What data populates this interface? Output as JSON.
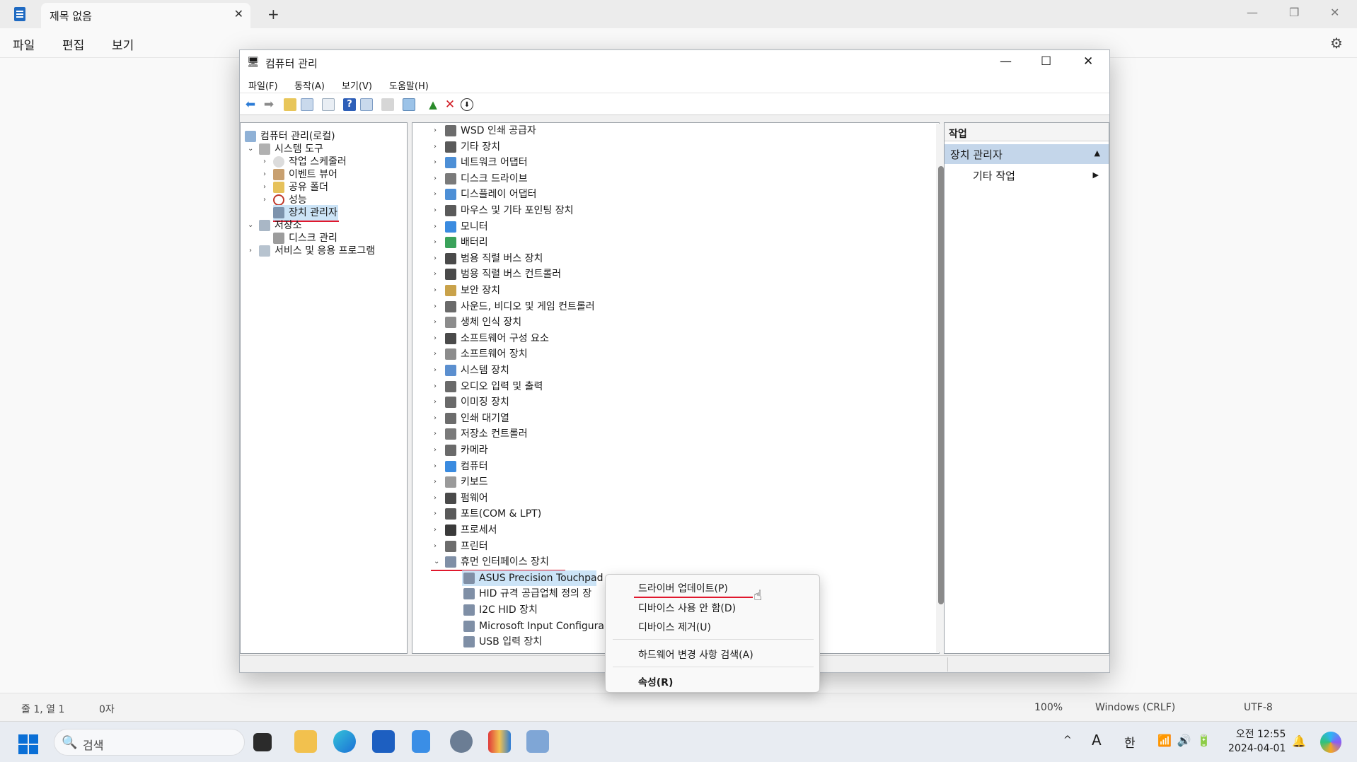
{
  "notepad": {
    "tab_title": "제목 없음",
    "menu": [
      "파일",
      "편집",
      "보기"
    ],
    "status": {
      "position": "줄 1, 열 1",
      "chars": "0자",
      "zoom": "100%",
      "eol": "Windows (CRLF)",
      "encoding": "UTF-8"
    }
  },
  "cm": {
    "title": "컴퓨터 관리",
    "menu": [
      "파일(F)",
      "동작(A)",
      "보기(V)",
      "도움말(H)"
    ],
    "tree": [
      {
        "label": "컴퓨터 관리(로컬)"
      },
      {
        "label": "시스템 도구"
      },
      {
        "label": "작업 스케줄러"
      },
      {
        "label": "이벤트 뷰어"
      },
      {
        "label": "공유 폴더"
      },
      {
        "label": "성능"
      },
      {
        "label": "장치 관리자"
      },
      {
        "label": "저장소"
      },
      {
        "label": "디스크 관리"
      },
      {
        "label": "서비스 및 응용 프로그램"
      }
    ],
    "devices": [
      {
        "label": "WSD 인쇄 공급자"
      },
      {
        "label": "기타 장치"
      },
      {
        "label": "네트워크 어댑터"
      },
      {
        "label": "디스크 드라이브"
      },
      {
        "label": "디스플레이 어댑터"
      },
      {
        "label": "마우스 및 기타 포인팅 장치"
      },
      {
        "label": "모니터"
      },
      {
        "label": "배터리"
      },
      {
        "label": "범용 직렬 버스 장치"
      },
      {
        "label": "범용 직렬 버스 컨트롤러"
      },
      {
        "label": "보안 장치"
      },
      {
        "label": "사운드, 비디오 및 게임 컨트롤러"
      },
      {
        "label": "생체 인식 장치"
      },
      {
        "label": "소프트웨어 구성 요소"
      },
      {
        "label": "소프트웨어 장치"
      },
      {
        "label": "시스템 장치"
      },
      {
        "label": "오디오 입력 및 출력"
      },
      {
        "label": "이미징 장치"
      },
      {
        "label": "인쇄 대기열"
      },
      {
        "label": "저장소 컨트롤러"
      },
      {
        "label": "카메라"
      },
      {
        "label": "컴퓨터"
      },
      {
        "label": "키보드"
      },
      {
        "label": "펌웨어"
      },
      {
        "label": "포트(COM & LPT)"
      },
      {
        "label": "프로세서"
      },
      {
        "label": "프린터"
      },
      {
        "label": "휴먼 인터페이스 장치"
      }
    ],
    "hid_children": [
      {
        "label": "ASUS Precision Touchpad"
      },
      {
        "label": "HID 규격 공급업체 정의 장"
      },
      {
        "label": "I2C HID 장치"
      },
      {
        "label": "Microsoft Input Configura"
      },
      {
        "label": "USB 입력 장치"
      }
    ],
    "actions": {
      "header": "작업",
      "section": "장치 관리자",
      "other": "기타 작업"
    }
  },
  "context_menu": {
    "items": [
      "드라이버 업데이트(P)",
      "디바이스 사용 안 함(D)",
      "디바이스 제거(U)",
      "하드웨어 변경 사항 검색(A)",
      "속성(R)"
    ]
  },
  "taskbar": {
    "search_placeholder": "검색",
    "ime_mode": "A",
    "ime_lang": "한",
    "time": "오전 12:55",
    "date": "2024-04-01"
  }
}
